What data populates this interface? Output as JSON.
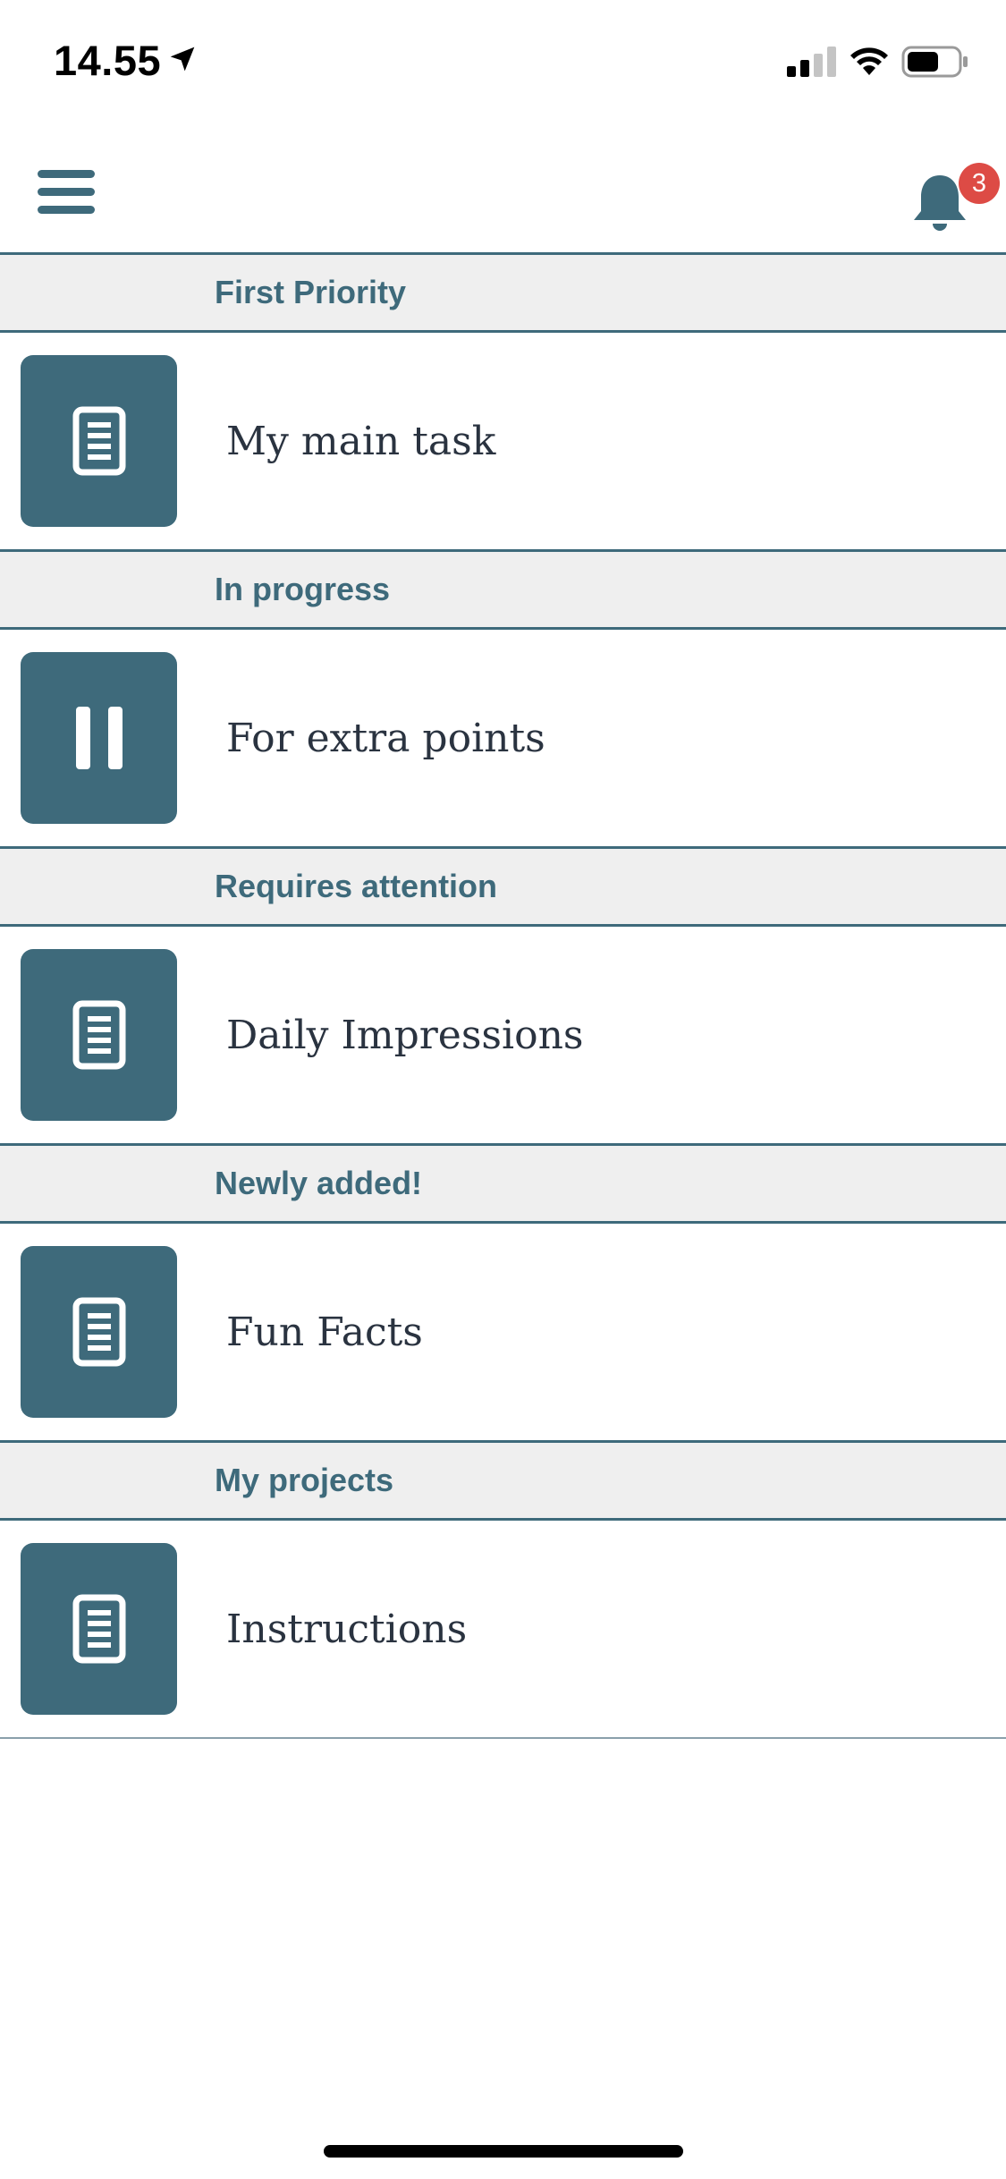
{
  "status_bar": {
    "time": "14.55"
  },
  "header": {
    "notification_count": "3",
    "accent_color": "#3e6a7b",
    "badge_color": "#dd4b45"
  },
  "sections": [
    {
      "title": "First Priority",
      "item": {
        "title": "My main task",
        "icon": "document-icon"
      }
    },
    {
      "title": "In progress",
      "item": {
        "title": "For extra points",
        "icon": "pause-icon"
      }
    },
    {
      "title": "Requires attention",
      "item": {
        "title": "Daily Impressions",
        "icon": "document-icon"
      }
    },
    {
      "title": "Newly added!",
      "item": {
        "title": "Fun Facts",
        "icon": "document-icon"
      }
    },
    {
      "title": "My projects",
      "item": {
        "title": "Instructions",
        "icon": "document-icon"
      }
    }
  ]
}
